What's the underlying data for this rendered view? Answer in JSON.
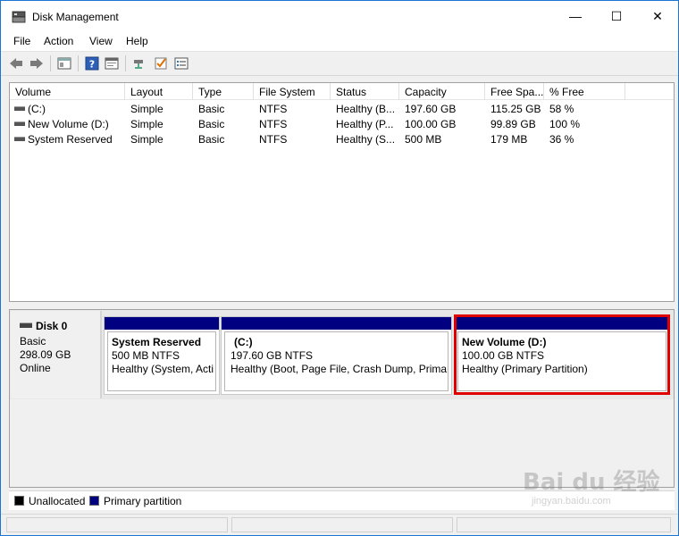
{
  "window": {
    "title": "Disk Management",
    "minimize_glyph": "—",
    "maximize_glyph": "☐",
    "close_glyph": "✕"
  },
  "menu": [
    "File",
    "Action",
    "View",
    "Help"
  ],
  "toolbar": {
    "icons": [
      "back-arrow-icon",
      "forward-arrow-icon",
      "properties-icon",
      "help-icon",
      "console-icon",
      "connect-icon",
      "check-icon",
      "list-view-icon"
    ]
  },
  "volume_list": {
    "columns": [
      "Volume",
      "Layout",
      "Type",
      "File System",
      "Status",
      "Capacity",
      "Free Spa...",
      "% Free"
    ],
    "rows": [
      [
        "(C:)",
        "Simple",
        "Basic",
        "NTFS",
        "Healthy (B...",
        "197.60 GB",
        "115.25 GB",
        "58 %"
      ],
      [
        "New Volume (D:)",
        "Simple",
        "Basic",
        "NTFS",
        "Healthy (P...",
        "100.00 GB",
        "99.89 GB",
        "100 %"
      ],
      [
        "System Reserved",
        "Simple",
        "Basic",
        "NTFS",
        "Healthy (S...",
        "500 MB",
        "179 MB",
        "36 %"
      ]
    ]
  },
  "disk": {
    "name": "Disk 0",
    "type": "Basic",
    "size": "298.09 GB",
    "state": "Online",
    "partitions": [
      {
        "name": "System Reserved",
        "size": "500 MB NTFS",
        "status": "Healthy (System, Acti"
      },
      {
        "name": "(C:)",
        "size": "197.60 GB NTFS",
        "status": "Healthy (Boot, Page File, Crash Dump, Primary"
      },
      {
        "name": "New Volume  (D:)",
        "size": "100.00 GB NTFS",
        "status": "Healthy (Primary Partition)"
      }
    ]
  },
  "legend": [
    {
      "label": "Unallocated",
      "color": "#000000"
    },
    {
      "label": "Primary partition",
      "color": "#000080"
    }
  ],
  "colors": {
    "partition_bar": "#000080",
    "highlight": "#e00000",
    "window_border": "#1a76d2"
  },
  "watermark": {
    "main": "Bai du 经验",
    "sub": "jingyan.baidu.com"
  }
}
